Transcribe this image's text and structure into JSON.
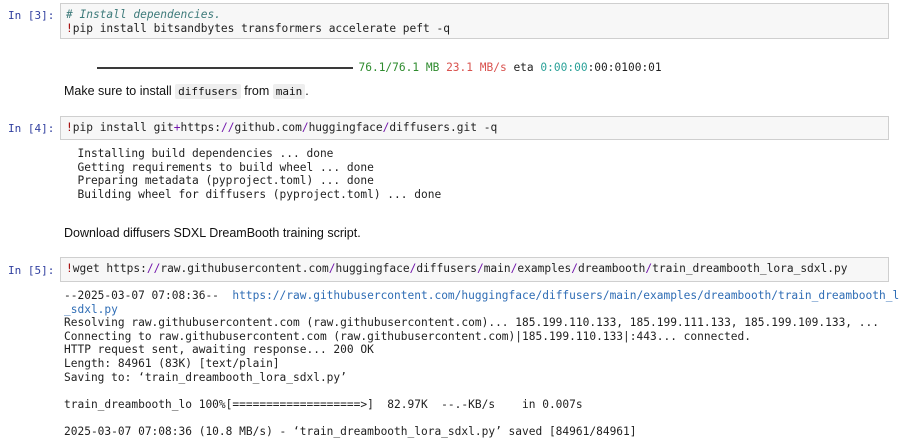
{
  "cells": {
    "c3": {
      "prompt": "In [3]:",
      "comment": "# Install dependencies.",
      "bang": "!",
      "cmd": "pip install bitsandbytes transformers accelerate peft -q",
      "progress": {
        "size": "76.1/76.1 MB",
        "speed": "23.1 MB/s",
        "eta_label": "eta",
        "eta": "0:00:00",
        "tail": ":00:0100:01",
        "fraction": 1.0
      }
    },
    "md1": {
      "pre": "Make sure to install ",
      "code1": "diffusers",
      "mid": " from ",
      "code2": "main",
      "post": "."
    },
    "c4": {
      "prompt": "In [4]:",
      "bang": "!",
      "cmd_a": "pip install git",
      "plus": "+",
      "cmd_b": "https:",
      "slash": "//",
      "cmd_c": "github.com",
      "s1": "/",
      "cmd_d": "huggingface",
      "s2": "/",
      "cmd_e": "diffusers.git",
      "flag": " -q",
      "output": [
        "  Installing build dependencies ... done",
        "  Getting requirements to build wheel ... done",
        "  Preparing metadata (pyproject.toml) ... done",
        "  Building wheel for diffusers (pyproject.toml) ... done"
      ]
    },
    "md2": {
      "text": "Download diffusers SDXL DreamBooth training script."
    },
    "c5": {
      "prompt": "In [5]:",
      "bang": "!",
      "cmd_a": "wget https:",
      "slash": "//",
      "cmd_b": "raw.githubusercontent.com",
      "s1": "/",
      "cmd_c": "huggingface",
      "s2": "/",
      "cmd_d": "diffusers",
      "s3": "/",
      "cmd_e": "main",
      "s4": "/",
      "cmd_f": "examples",
      "s5": "/",
      "cmd_g": "dreambooth",
      "s6": "/",
      "cmd_h": "train_dreambooth_lora_sdxl.py",
      "out_line1_pre": "--2025-03-07 07:08:36--  ",
      "out_line1_link": "https://raw.githubusercontent.com/huggingface/diffusers/main/examples/dreambooth/train_dreambooth_lora",
      "out_line2_link": "_sdxl.py",
      "out_lines": [
        "Resolving raw.githubusercontent.com (raw.githubusercontent.com)... 185.199.110.133, 185.199.111.133, 185.199.109.133, ...",
        "Connecting to raw.githubusercontent.com (raw.githubusercontent.com)|185.199.110.133|:443... connected.",
        "HTTP request sent, awaiting response... 200 OK",
        "Length: 84961 (83K) [text/plain]",
        "Saving to: ‘train_dreambooth_lora_sdxl.py’",
        "",
        "train_dreambooth_lo 100%[===================>]  82.97K  --.-KB/s    in 0.007s",
        "",
        "2025-03-07 07:08:36 (10.8 MB/s) - ‘train_dreambooth_lora_sdxl.py’ saved [84961/84961]"
      ]
    }
  }
}
